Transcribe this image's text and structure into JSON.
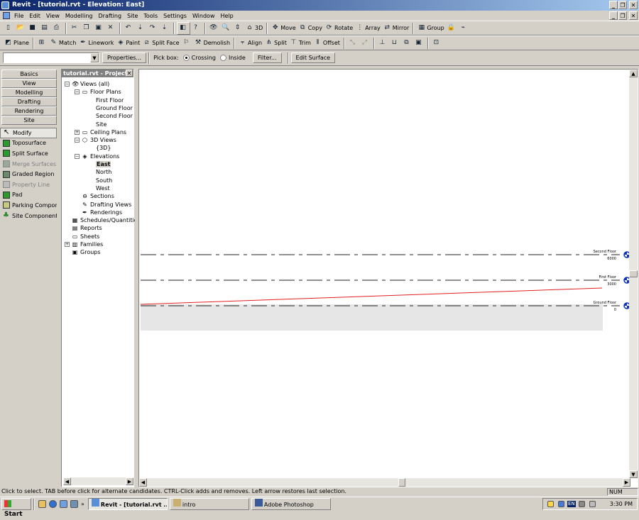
{
  "window": {
    "title": "Revit - [tutorial.rvt - Elevation: East]"
  },
  "menu": [
    "File",
    "Edit",
    "View",
    "Modelling",
    "Drafting",
    "Site",
    "Tools",
    "Settings",
    "Window",
    "Help"
  ],
  "toolbar1": {
    "move": "Move",
    "copy": "Copy",
    "rotate": "Rotate",
    "array": "Array",
    "mirror": "Mirror",
    "group": "Group",
    "threed": "3D"
  },
  "toolbar2": {
    "plane": "Plane",
    "match": "Match",
    "linework": "Linework",
    "paint": "Paint",
    "split_face": "Split Face",
    "demolish": "Demolish",
    "align": "Align",
    "split": "Split",
    "trim": "Trim",
    "offset": "Offset"
  },
  "options": {
    "properties": "Properties...",
    "pick_box": "Pick box:",
    "crossing": "Crossing",
    "inside": "Inside",
    "filter": "Filter...",
    "edit_surface": "Edit Surface"
  },
  "design_tabs": [
    "Basics",
    "View",
    "Modelling",
    "Drafting",
    "Rendering",
    "Site"
  ],
  "site_tools": [
    {
      "label": "Modify",
      "enabled": true
    },
    {
      "label": "Toposurface",
      "enabled": true
    },
    {
      "label": "Split Surface",
      "enabled": true
    },
    {
      "label": "Merge Surfaces",
      "enabled": false
    },
    {
      "label": "Graded Region",
      "enabled": true
    },
    {
      "label": "Property Line",
      "enabled": false
    },
    {
      "label": "Pad",
      "enabled": true
    },
    {
      "label": "Parking Component",
      "enabled": true
    },
    {
      "label": "Site Component",
      "enabled": true
    }
  ],
  "browser": {
    "title": "tutorial.rvt - Project",
    "tree": [
      {
        "label": "Views (all)",
        "level": 0,
        "pm": "-",
        "icon": "eye-icon"
      },
      {
        "label": "Floor Plans",
        "level": 1,
        "pm": "-",
        "icon": "floor-plan-icon"
      },
      {
        "label": "First Floor",
        "level": 2
      },
      {
        "label": "Ground Floor",
        "level": 2
      },
      {
        "label": "Second Floor",
        "level": 2
      },
      {
        "label": "Site",
        "level": 2
      },
      {
        "label": "Ceiling Plans",
        "level": 1,
        "pm": "+",
        "icon": "ceiling-plan-icon"
      },
      {
        "label": "3D Views",
        "level": 1,
        "pm": "-",
        "icon": "cube-icon"
      },
      {
        "label": "{3D}",
        "level": 2
      },
      {
        "label": "Elevations",
        "level": 1,
        "pm": "-",
        "icon": "elevation-icon"
      },
      {
        "label": "East",
        "level": 2,
        "selected": true
      },
      {
        "label": "North",
        "level": 2
      },
      {
        "label": "South",
        "level": 2
      },
      {
        "label": "West",
        "level": 2
      },
      {
        "label": "Sections",
        "level": 1,
        "icon": "section-icon"
      },
      {
        "label": "Drafting Views",
        "level": 1,
        "icon": "drafting-icon"
      },
      {
        "label": "Renderings",
        "level": 1,
        "icon": "rendering-icon"
      },
      {
        "label": "Schedules/Quantities",
        "level": 0,
        "icon": "schedule-icon"
      },
      {
        "label": "Reports",
        "level": 0,
        "icon": "report-icon"
      },
      {
        "label": "Sheets",
        "level": 0,
        "icon": "sheet-icon"
      },
      {
        "label": "Families",
        "level": 0,
        "pm": "+",
        "icon": "family-icon"
      },
      {
        "label": "Groups",
        "level": 0,
        "icon": "group-icon"
      }
    ]
  },
  "levels": [
    {
      "name": "Second Floor",
      "elevation": "6000"
    },
    {
      "name": "First Floor",
      "elevation": "3000"
    },
    {
      "name": "Ground Floor",
      "elevation": "0"
    }
  ],
  "status": {
    "message": "Click to select. TAB before click for alternate candidates. CTRL-Click adds and removes. Left arrow restores last selection.",
    "num": "NUM"
  },
  "taskbar": {
    "start": "Start",
    "tasks": [
      "Revit - [tutorial.rvt ...",
      "intro",
      "Adobe Photoshop"
    ],
    "lang": "EN",
    "time": "3:30 PM"
  }
}
